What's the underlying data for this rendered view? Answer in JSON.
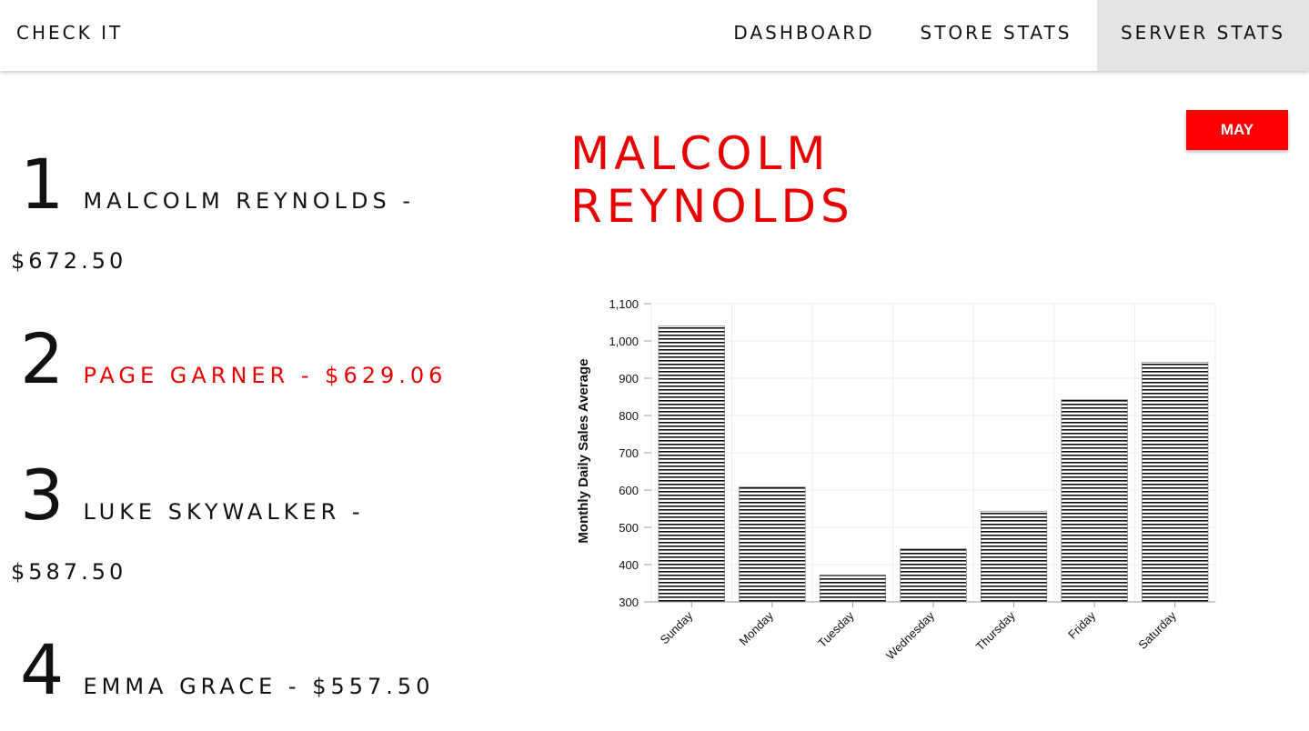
{
  "nav": {
    "brand": "CHECK IT",
    "items": [
      {
        "label": "DASHBOARD",
        "active": false
      },
      {
        "label": "STORE STATS",
        "active": false
      },
      {
        "label": "SERVER STATS",
        "active": true
      }
    ]
  },
  "leaderboard": [
    {
      "rank": "1",
      "name": "MALCOLM REYNOLDS -",
      "amount": "$672.50"
    },
    {
      "rank": "2",
      "name": "PAGE GARNER - $629.06"
    },
    {
      "rank": "3",
      "name": "LUKE SKYWALKER -",
      "amount": "$587.50"
    },
    {
      "rank": "4",
      "name": "EMMA GRACE - $557.50"
    }
  ],
  "month_button": "MAY",
  "selected_server": {
    "name": "MALCOLM REYNOLDS"
  },
  "colors": {
    "accent": "#ff0000",
    "active_nav_bg": "#e4e4e4",
    "bar_line": "#111111"
  },
  "chart_data": {
    "type": "bar",
    "categories": [
      "Sunday",
      "Monday",
      "Tuesday",
      "Wednesday",
      "Thursday",
      "Friday",
      "Saturday"
    ],
    "values": [
      1040,
      608,
      372,
      443,
      542,
      843,
      943
    ],
    "ylabel": "Monthly Daily Sales Average",
    "ylim": [
      300,
      1100
    ],
    "yticks": [
      "300",
      "400",
      "500",
      "600",
      "700",
      "800",
      "900",
      "1,000",
      "1,100"
    ],
    "grid": true,
    "fill_pattern": "horizontal-stripes"
  }
}
